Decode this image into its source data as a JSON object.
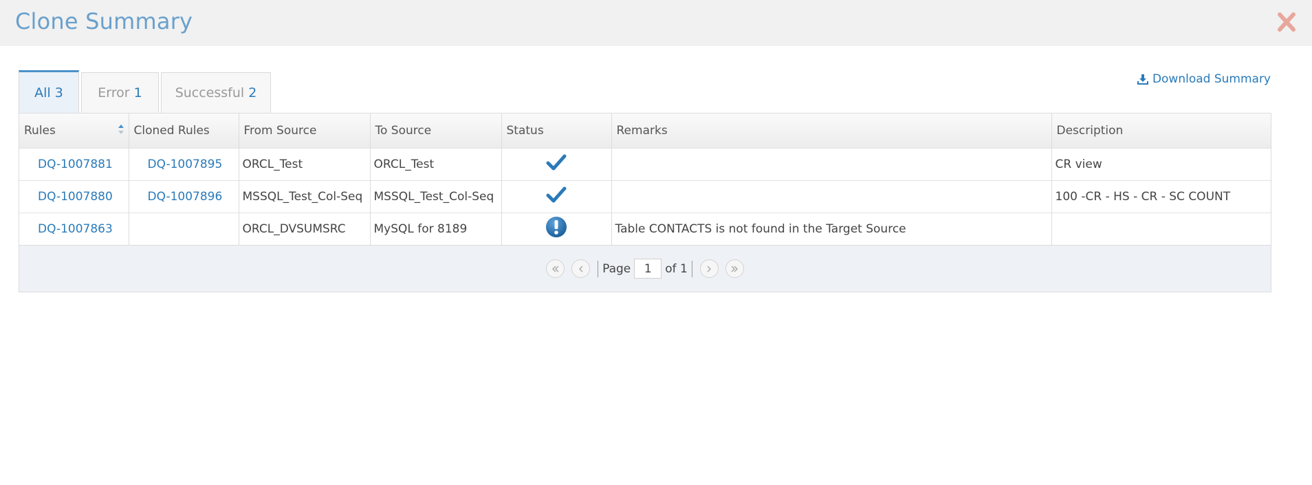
{
  "header": {
    "title": "Clone Summary"
  },
  "download_label": "Download Summary",
  "tabs": [
    {
      "label": "All",
      "count": "3"
    },
    {
      "label": "Error",
      "count": "1"
    },
    {
      "label": "Successful",
      "count": "2"
    }
  ],
  "columns": [
    "Rules",
    "Cloned Rules",
    "From Source",
    "To Source",
    "Status",
    "Remarks",
    "Description"
  ],
  "rows": [
    {
      "rule": "DQ-1007881",
      "cloned": "DQ-1007895",
      "from": "ORCL_Test",
      "to": "ORCL_Test",
      "status": "success",
      "remarks": "",
      "description": "CR view"
    },
    {
      "rule": "DQ-1007880",
      "cloned": "DQ-1007896",
      "from": "MSSQL_Test_Col-Seq",
      "to": "MSSQL_Test_Col-Seq",
      "status": "success",
      "remarks": "",
      "description": "100 -CR - HS - CR - SC COUNT"
    },
    {
      "rule": "DQ-1007863",
      "cloned": "",
      "from": "ORCL_DVSUMSRC",
      "to": "MySQL for 8189",
      "status": "error",
      "remarks": "Table CONTACTS is not found in the Target Source",
      "description": ""
    }
  ],
  "pager": {
    "page_label": "Page",
    "current": "1",
    "of_label": "of 1"
  },
  "colors": {
    "accent": "#2a7ab9",
    "title": "#6aa0cc",
    "close": "#e8a79c"
  }
}
